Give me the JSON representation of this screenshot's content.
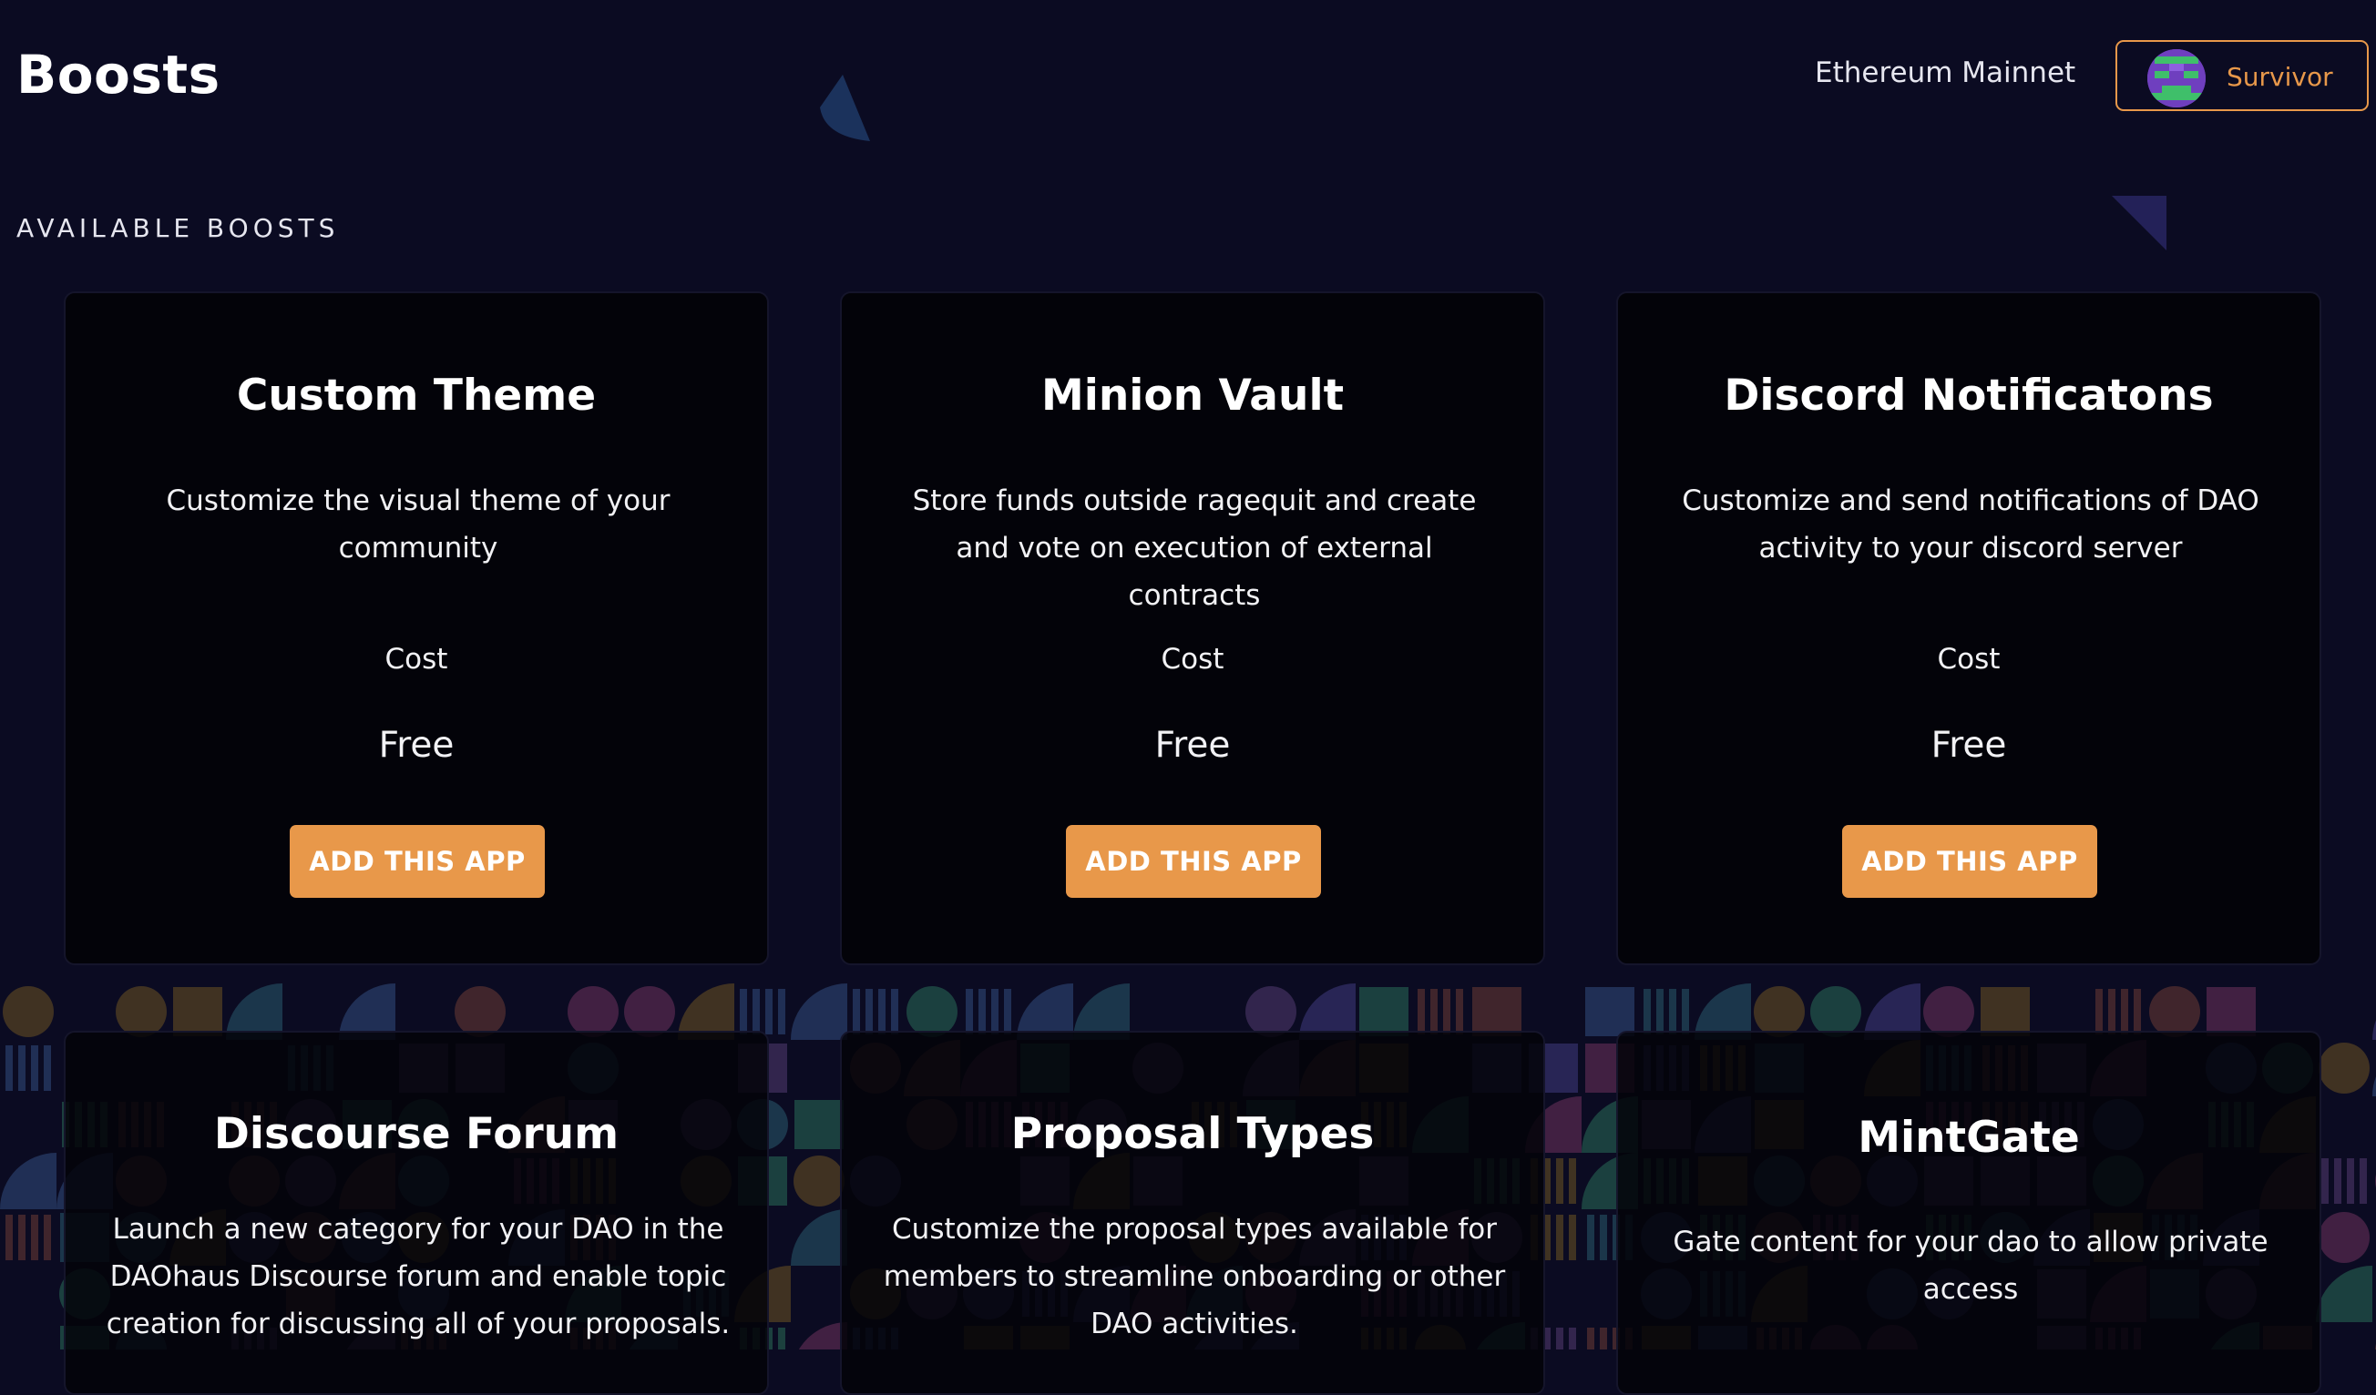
{
  "header": {
    "title": "Boosts",
    "network": "Ethereum Mainnet",
    "user": {
      "name": "Survivor",
      "avatar_icon": "pixel-avatar-icon"
    }
  },
  "section_label": "AVAILABLE BOOSTS",
  "colors": {
    "accent": "#e8984a",
    "background": "#0b0b22",
    "card": "#030309"
  },
  "cards": [
    {
      "title": "Custom Theme",
      "description": "Customize the visual theme of your community",
      "cost_label": "Cost",
      "cost": "Free",
      "button": "ADD THIS APP"
    },
    {
      "title": "Minion Vault",
      "description": "Store funds outside ragequit and create and vote on execution of external contracts",
      "cost_label": "Cost",
      "cost": "Free",
      "button": "ADD THIS APP"
    },
    {
      "title": "Discord Notificatons",
      "description": "Customize and send notifications of DAO activity to your discord server",
      "cost_label": "Cost",
      "cost": "Free",
      "button": "ADD THIS APP"
    },
    {
      "title": "Discourse Forum",
      "description": "Launch a new category for your DAO in the DAOhaus Discourse forum and enable topic creation for discussing all of your proposals."
    },
    {
      "title": "Proposal Types",
      "description": "Customize the proposal types available for members to streamline onboarding or other DAO activities."
    },
    {
      "title": "MintGate",
      "description": "Gate content for your dao to allow private access"
    }
  ]
}
